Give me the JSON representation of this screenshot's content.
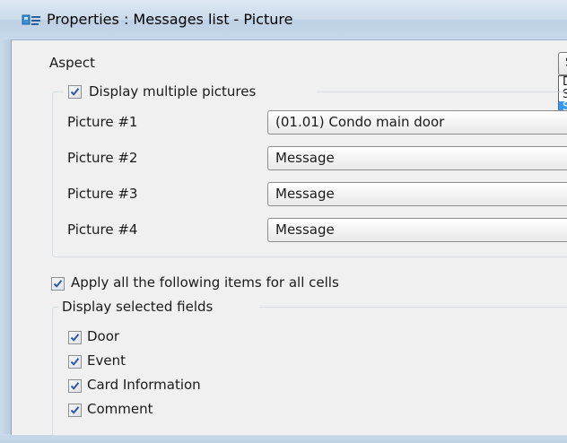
{
  "window": {
    "title": "Properties : Messages list - Picture"
  },
  "aspect": {
    "label": "Aspect",
    "combo_value": "S",
    "dropdown_items": [
      "D",
      "S",
      "S"
    ]
  },
  "pictures_group": {
    "checkbox_label": "Display multiple pictures",
    "checked": true,
    "rows": [
      {
        "label": "Picture #1",
        "value": "(01.01) Condo main door"
      },
      {
        "label": "Picture #2",
        "value": "Message"
      },
      {
        "label": "Picture #3",
        "value": "Message"
      },
      {
        "label": "Picture #4",
        "value": "Message"
      }
    ]
  },
  "apply_all": {
    "label": "Apply all the following items for all cells",
    "checked": true
  },
  "fields_group": {
    "title": "Display selected fields",
    "items": [
      {
        "label": "Door",
        "checked": true
      },
      {
        "label": "Event",
        "checked": true
      },
      {
        "label": "Card Information",
        "checked": true
      },
      {
        "label": "Comment",
        "checked": true
      }
    ]
  },
  "colors": {
    "selection": "#3399ff",
    "frame": "#c2d6e8",
    "dialog_bg": "#f0f0f0"
  }
}
